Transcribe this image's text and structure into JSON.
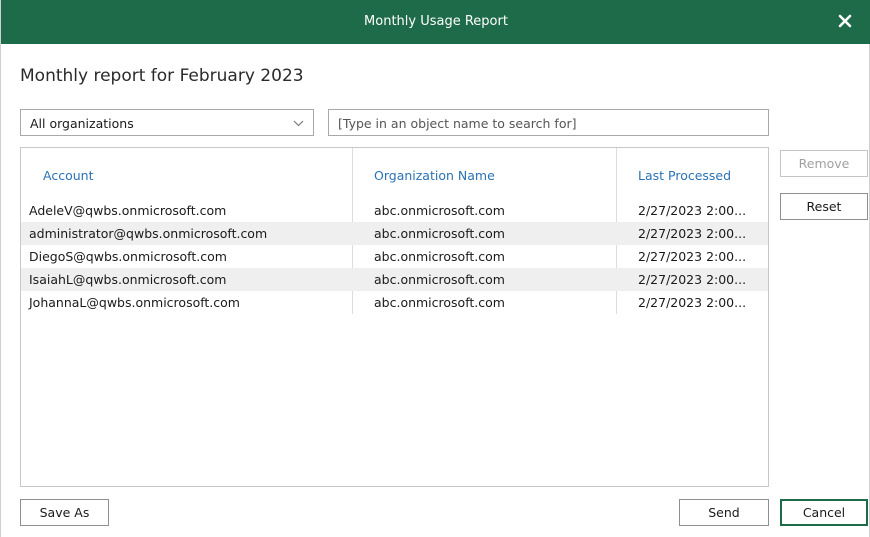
{
  "window": {
    "title": "Monthly Usage Report",
    "close_icon": "close-icon"
  },
  "heading": "Monthly report for February 2023",
  "filter": {
    "organizations_value": "All organizations",
    "search_placeholder": "[Type in an object name to search for]"
  },
  "table": {
    "columns": [
      "Account",
      "Organization Name",
      "Last Processed"
    ],
    "rows": [
      {
        "account": "AdeleV@qwbs.onmicrosoft.com",
        "organization": "abc.onmicrosoft.com",
        "last_processed": "2/27/2023 2:00..."
      },
      {
        "account": "administrator@qwbs.onmicrosoft.com",
        "organization": "abc.onmicrosoft.com",
        "last_processed": "2/27/2023 2:00..."
      },
      {
        "account": "DiegoS@qwbs.onmicrosoft.com",
        "organization": "abc.onmicrosoft.com",
        "last_processed": "2/27/2023 2:00..."
      },
      {
        "account": "IsaiahL@qwbs.onmicrosoft.com",
        "organization": "abc.onmicrosoft.com",
        "last_processed": "2/27/2023 2:00..."
      },
      {
        "account": "JohannaL@qwbs.onmicrosoft.com",
        "organization": "abc.onmicrosoft.com",
        "last_processed": "2/27/2023 2:00..."
      }
    ]
  },
  "buttons": {
    "remove": "Remove",
    "reset": "Reset",
    "save_as": "Save As",
    "send": "Send",
    "cancel": "Cancel"
  },
  "colors": {
    "titlebar": "#1e6b49",
    "header_text": "#2b72b5",
    "row_alt": "#efefef"
  }
}
